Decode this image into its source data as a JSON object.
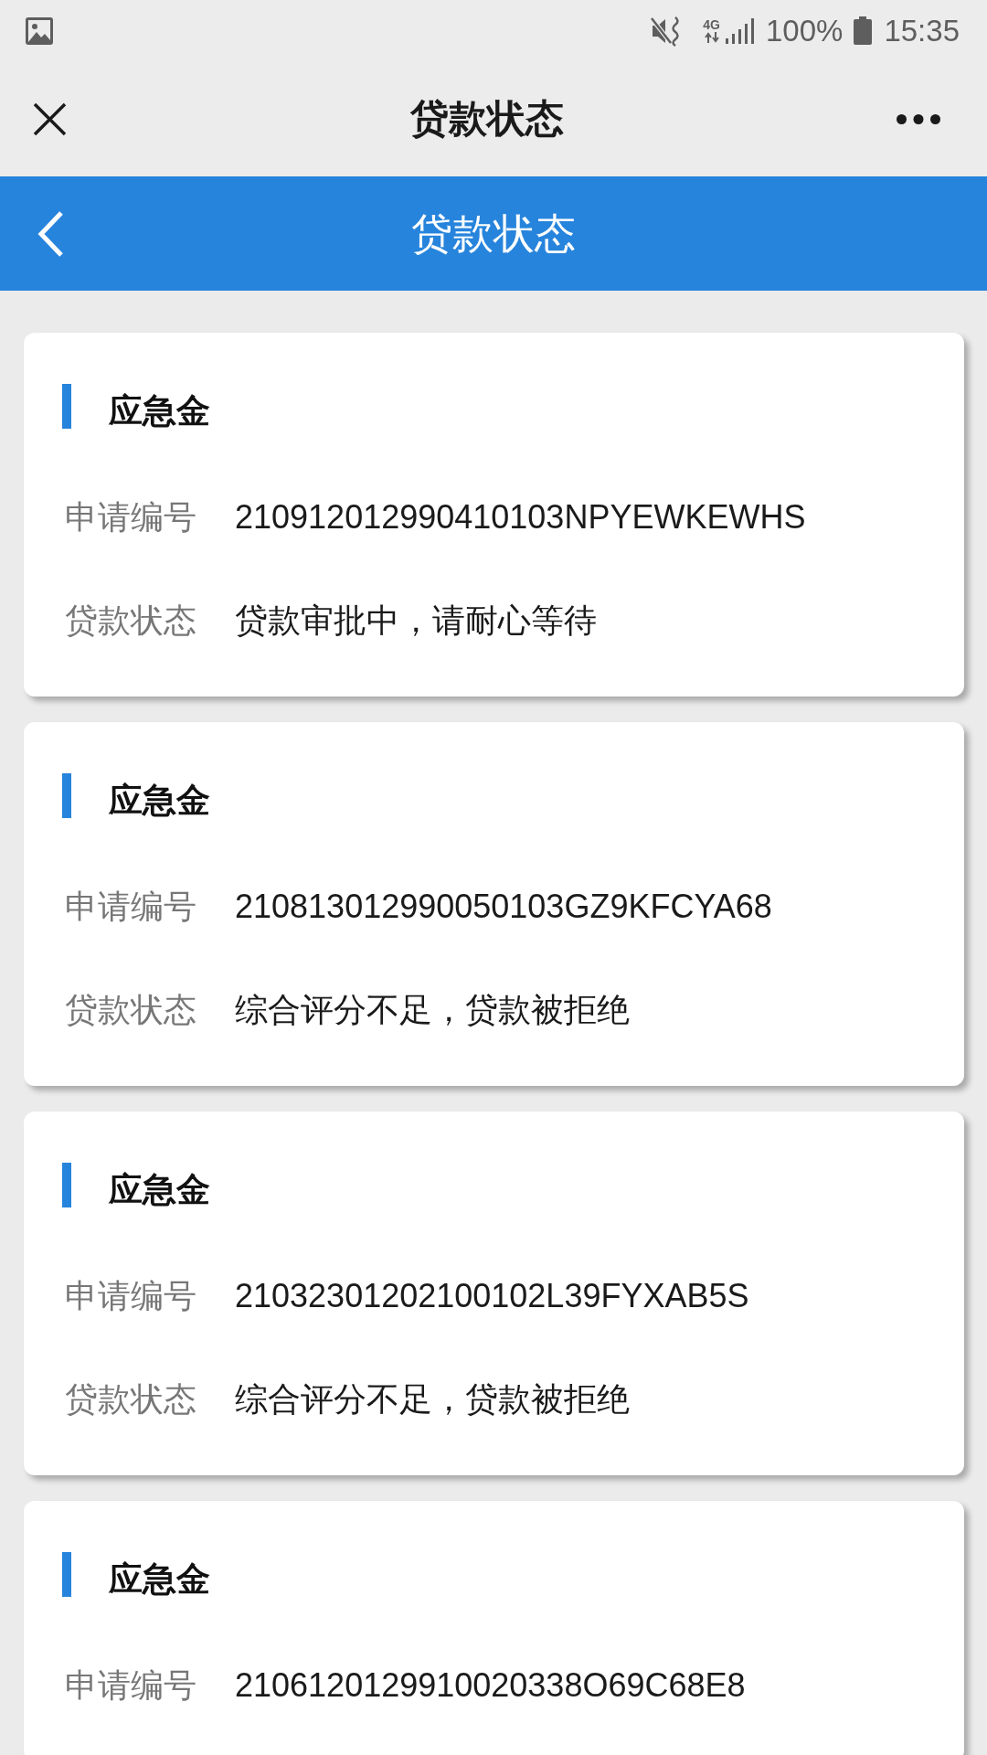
{
  "status_bar": {
    "network": "4G",
    "battery": "100%",
    "time": "15:35"
  },
  "nav_bar": {
    "title": "贷款状态"
  },
  "header": {
    "title": "贷款状态"
  },
  "cards": [
    {
      "title": "应急金",
      "fields": [
        {
          "label": "申请编号",
          "value": "210912012990410103NPYEWKEWHS"
        },
        {
          "label": "贷款状态",
          "value": "贷款审批中，请耐心等待"
        }
      ]
    },
    {
      "title": "应急金",
      "fields": [
        {
          "label": "申请编号",
          "value": "210813012990050103GZ9KFCYA68"
        },
        {
          "label": "贷款状态",
          "value": "综合评分不足，贷款被拒绝"
        }
      ]
    },
    {
      "title": "应急金",
      "fields": [
        {
          "label": "申请编号",
          "value": "21032301202100102L39FYXAB5S"
        },
        {
          "label": "贷款状态",
          "value": "综合评分不足，贷款被拒绝"
        }
      ]
    },
    {
      "title": "应急金",
      "fields": [
        {
          "label": "申请编号",
          "value": "2106120129910020338O69C68E8"
        }
      ]
    }
  ]
}
